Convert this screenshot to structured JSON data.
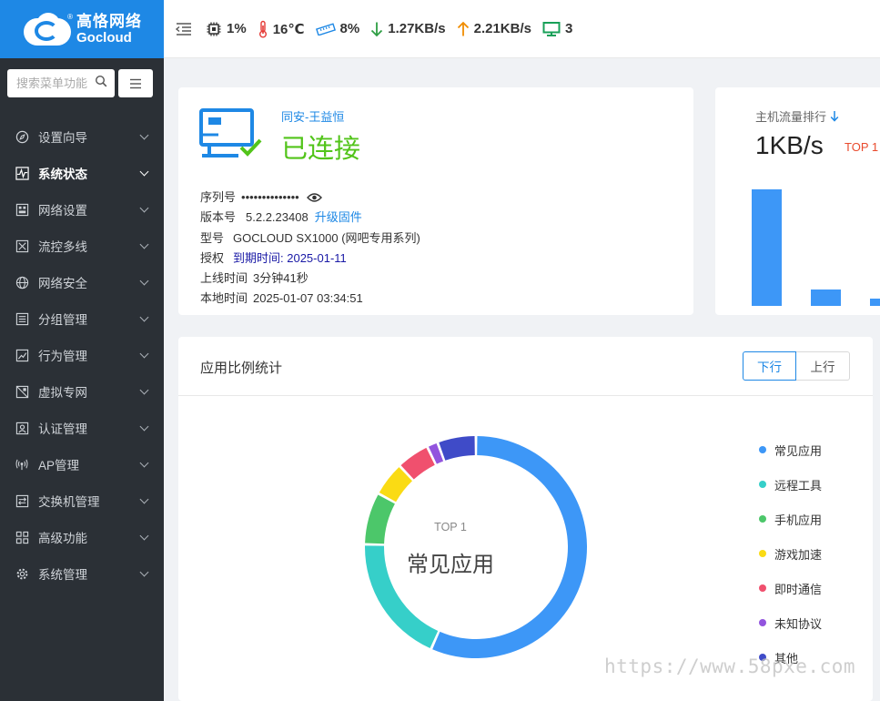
{
  "brand": {
    "cn": "高恪网络",
    "en": "Gocloud",
    "reg": "®"
  },
  "search": {
    "placeholder": "搜索菜单功能"
  },
  "sidebar": {
    "items": [
      {
        "label": "设置向导",
        "icon": "compass-icon"
      },
      {
        "label": "系统状态",
        "icon": "pulse-chart-icon",
        "active": true
      },
      {
        "label": "网络设置",
        "icon": "network-icon"
      },
      {
        "label": "流控多线",
        "icon": "flow-control-icon"
      },
      {
        "label": "网络安全",
        "icon": "globe-icon"
      },
      {
        "label": "分组管理",
        "icon": "list-icon"
      },
      {
        "label": "行为管理",
        "icon": "trend-chart-icon"
      },
      {
        "label": "虚拟专网",
        "icon": "vpn-icon"
      },
      {
        "label": "认证管理",
        "icon": "user-card-icon"
      },
      {
        "label": "AP管理",
        "icon": "wireless-icon"
      },
      {
        "label": "交换机管理",
        "icon": "switch-icon"
      },
      {
        "label": "高级功能",
        "icon": "grid-icon"
      },
      {
        "label": "系统管理",
        "icon": "gear-icon"
      }
    ]
  },
  "topbar": {
    "cpu": "1%",
    "temperature": "16℃",
    "memory": "8%",
    "download": "1.27KB/s",
    "upload": "2.21KB/s",
    "terminals": "3"
  },
  "device": {
    "host_name": "同安-王益恒",
    "status": "已连接",
    "serial_label": "序列号",
    "serial_value": "••••••••••••••",
    "version_label": "版本号",
    "version_value": "5.2.2.23408",
    "upgrade_link": "升级固件",
    "model_label": "型号",
    "model_value": "GOCLOUD SX1000 (网吧专用系列)",
    "license_label": "授权",
    "license_value": "到期时间: 2025-01-11",
    "uptime_label": "上线时间",
    "uptime_value": "3分钟41秒",
    "localtime_label": "本地时间",
    "localtime_value": "2025-01-07 03:34:51"
  },
  "traffic_rank": {
    "title": "主机流量排行",
    "value": "1KB/s",
    "top": "TOP 1",
    "bars": [
      100,
      14,
      6
    ]
  },
  "app_ratio": {
    "title": "应用比例统计",
    "btn_down": "下行",
    "btn_up": "上行",
    "center_top": "TOP 1",
    "center_name": "常见应用",
    "legend": [
      {
        "label": "常见应用",
        "color": "#3d97f7"
      },
      {
        "label": "远程工具",
        "color": "#36cfc9"
      },
      {
        "label": "手机应用",
        "color": "#4cc76a"
      },
      {
        "label": "游戏加速",
        "color": "#fadb14"
      },
      {
        "label": "即时通信",
        "color": "#f0506e"
      },
      {
        "label": "未知协议",
        "color": "#9254de"
      },
      {
        "label": "其他",
        "color": "#3f4bc8"
      }
    ],
    "shares": [
      56.6,
      18.8,
      7.6,
      5.0,
      4.8,
      1.6,
      5.6
    ]
  },
  "watermark": "https://www.58pxe.com"
}
